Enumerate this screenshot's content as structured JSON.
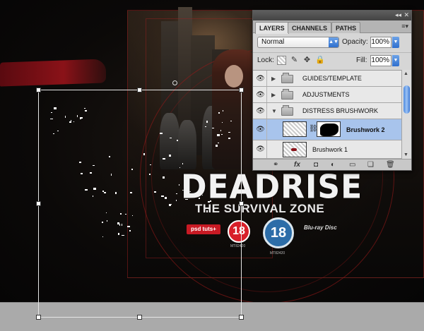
{
  "artwork": {
    "title": "DEADRISE",
    "subtitle": "THE SURVIVAL ZONE",
    "publisher_logo": "psd tuts+",
    "rating_red": "18",
    "rating_blue": "18",
    "rating_code_red": "MT82420",
    "rating_code_blue": "MT82420",
    "format_logo": "Blu-ray Disc"
  },
  "panel": {
    "tabs": [
      {
        "label": "LAYERS",
        "active": true
      },
      {
        "label": "CHANNELS",
        "active": false
      },
      {
        "label": "PATHS",
        "active": false
      }
    ],
    "titlebar_collapse": "◂◂",
    "titlebar_close": "✕",
    "menu_icon": "≡▾",
    "blend_mode": "Normal",
    "opacity_label": "Opacity:",
    "opacity_value": "100%",
    "lock_label": "Lock:",
    "fill_label": "Fill:",
    "fill_value": "100%",
    "layers": [
      {
        "name": "GUIDES/TEMPLATE",
        "type": "group",
        "expanded": false,
        "visible": true
      },
      {
        "name": "ADJUSTMENTS",
        "type": "group",
        "expanded": false,
        "visible": true
      },
      {
        "name": "DISTRESS BRUSHWORK",
        "type": "group",
        "expanded": true,
        "visible": true
      },
      {
        "name": "Brushwork 2",
        "type": "layer-with-mask",
        "selected": true,
        "visible": true
      },
      {
        "name": "Brushwork 1",
        "type": "layer",
        "selected": false,
        "visible": true
      }
    ],
    "footer_icons": [
      "link-icon",
      "fx-icon",
      "mask-icon",
      "adjustment-icon",
      "folder-icon",
      "new-layer-icon",
      "trash-icon"
    ],
    "footer_glyphs": [
      "⚭",
      "fx",
      "◘",
      "◐",
      "▭",
      "❏",
      "🗑"
    ]
  },
  "colors": {
    "selection_highlight": "#a8c4ec",
    "accent_blue": "#2f6fce",
    "brush_red": "#8a1218"
  }
}
